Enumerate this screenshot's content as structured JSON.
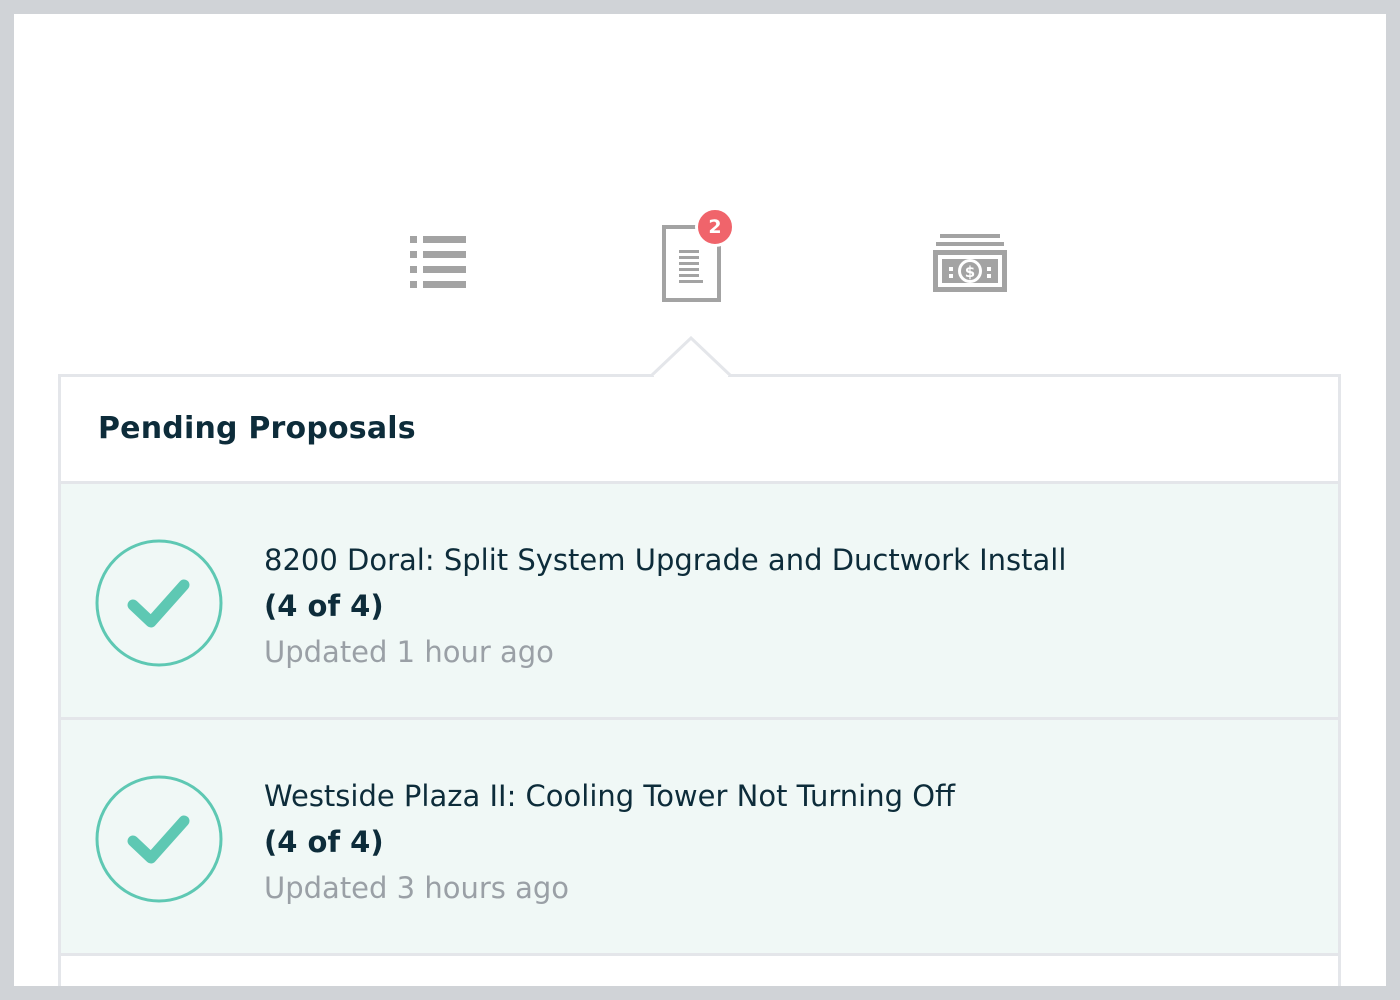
{
  "tabs": [
    {
      "id": "list",
      "icon": "list-icon"
    },
    {
      "id": "proposals",
      "icon": "document-icon",
      "badge": "2",
      "active": true
    },
    {
      "id": "invoices",
      "icon": "money-icon"
    }
  ],
  "panel": {
    "title": "Pending Proposals"
  },
  "proposals": [
    {
      "title": "8200 Doral: Split System Upgrade and Ductwork Install",
      "progress": "(4 of 4)",
      "updated": "Updated 1 hour ago",
      "status_icon": "check-circle-icon"
    },
    {
      "title": "Westside Plaza II: Cooling Tower Not Turning Off",
      "progress": "(4 of 4)",
      "updated": "Updated 3 hours ago",
      "status_icon": "check-circle-icon"
    }
  ],
  "colors": {
    "accent_teal": "#5ec8b3",
    "badge_red": "#f0646b",
    "row_background": "#f0f8f6",
    "icon_gray": "#a3a3a3",
    "text_dark": "#0d2c3a",
    "text_muted": "#9aa0a6"
  }
}
